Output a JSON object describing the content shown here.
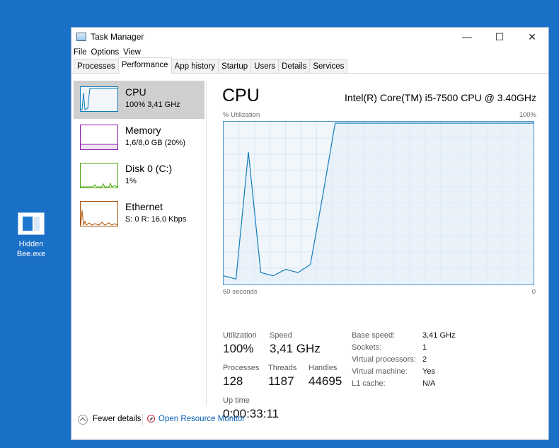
{
  "desktop": {
    "icon_label": "Hidden Bee.exe"
  },
  "window": {
    "title": "Task Manager",
    "controls": {
      "minimize": "—",
      "maximize": "☐",
      "close": "✕"
    }
  },
  "menu": [
    "File",
    "Options",
    "View"
  ],
  "tabs": [
    {
      "label": "Processes",
      "active": false
    },
    {
      "label": "Performance",
      "active": true
    },
    {
      "label": "App history",
      "active": false
    },
    {
      "label": "Startup",
      "active": false
    },
    {
      "label": "Users",
      "active": false
    },
    {
      "label": "Details",
      "active": false
    },
    {
      "label": "Services",
      "active": false
    }
  ],
  "sidebar": [
    {
      "name": "CPU",
      "sub": "100% 3,41 GHz",
      "color": "#117dbb",
      "selected": true
    },
    {
      "name": "Memory",
      "sub": "1,6/8,0 GB (20%)",
      "color": "#8b12ae",
      "selected": false
    },
    {
      "name": "Disk 0 (C:)",
      "sub": "1%",
      "color": "#4da60c",
      "selected": false
    },
    {
      "name": "Ethernet",
      "sub": "S: 0 R: 16,0 Kbps",
      "color": "#a74f01",
      "selected": false
    }
  ],
  "main": {
    "title": "CPU",
    "cpu_model": "Intel(R) Core(TM) i5-7500 CPU @ 3.40GHz",
    "util_label": "% Utilization",
    "max_label": "100%",
    "time_label": "60 seconds",
    "zero_label": "0",
    "graph_color": "#117dbb",
    "graph_values": [
      5,
      3,
      82,
      7,
      5,
      9,
      7,
      12,
      55,
      100,
      100,
      100,
      100,
      100,
      100,
      100,
      100,
      100,
      100,
      100,
      100,
      100,
      100,
      100,
      100,
      100
    ],
    "stats": {
      "utilization": {
        "label": "Utilization",
        "value": "100%"
      },
      "speed": {
        "label": "Speed",
        "value": "3,41 GHz"
      },
      "processes": {
        "label": "Processes",
        "value": "128"
      },
      "threads": {
        "label": "Threads",
        "value": "1187"
      },
      "handles": {
        "label": "Handles",
        "value": "44695"
      },
      "uptime": {
        "label": "Up time",
        "value": "0:00:33:11"
      }
    },
    "details": [
      {
        "key": "Base speed:",
        "value": "3,41 GHz"
      },
      {
        "key": "Sockets:",
        "value": "1"
      },
      {
        "key": "Virtual processors:",
        "value": "2"
      },
      {
        "key": "Virtual machine:",
        "value": "Yes"
      },
      {
        "key": "L1 cache:",
        "value": "N/A"
      }
    ]
  },
  "footer": {
    "fewer_details": "Fewer details",
    "resource_monitor": "Open Resource Monitor"
  }
}
